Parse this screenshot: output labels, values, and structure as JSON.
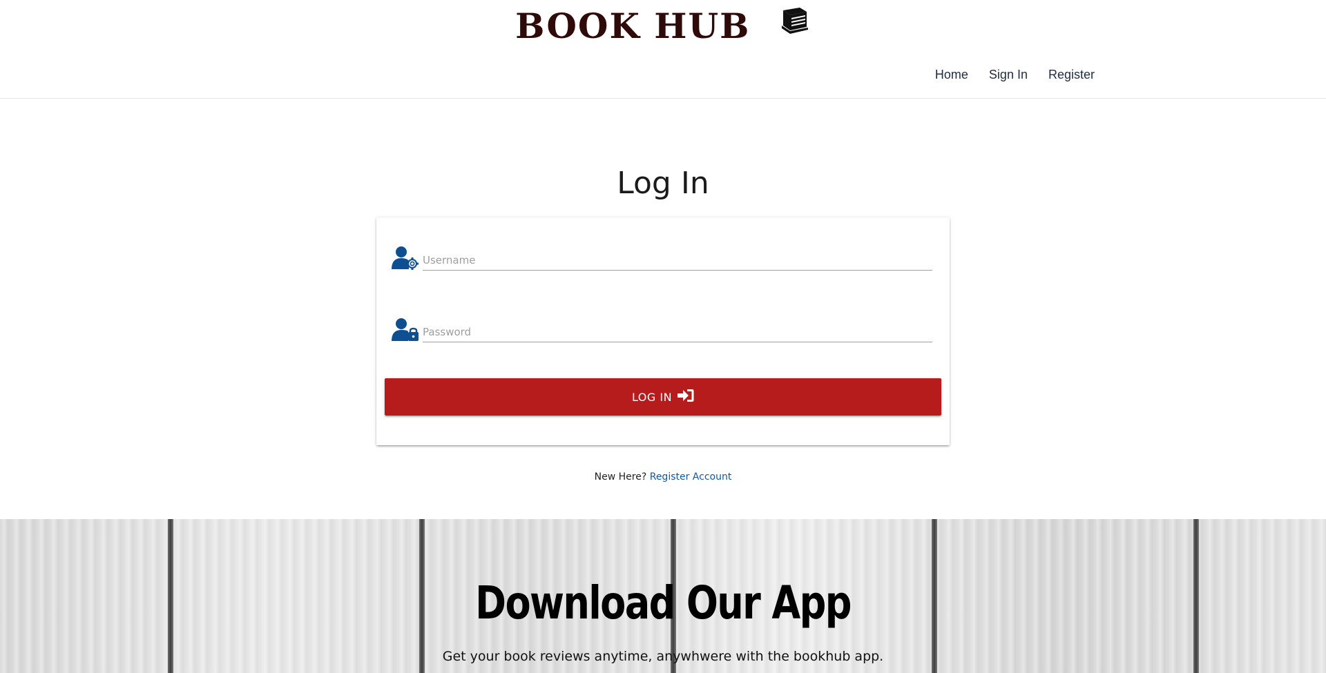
{
  "header": {
    "brand": "BOOK HUB",
    "brand_icon": "book-stack-icon",
    "nav": [
      {
        "label": "Home"
      },
      {
        "label": "Sign In"
      },
      {
        "label": "Register"
      }
    ]
  },
  "main": {
    "title": "Log In",
    "username": {
      "placeholder": "Username",
      "value": "",
      "icon": "user-gear-icon"
    },
    "password": {
      "placeholder": "Password",
      "value": "",
      "icon": "user-lock-icon"
    },
    "login_button": {
      "label": "Log In",
      "icon": "sign-in-icon"
    },
    "register_prompt": "New Here?",
    "register_link": "Register Account"
  },
  "banner": {
    "title": "Download Our App",
    "subtitle": "Get your book reviews anytime, anywhwere with the bookhub app."
  },
  "colors": {
    "brand": "#2e0a09",
    "accent_red": "#b71c1c",
    "icon_blue": "#0d4f91",
    "link_blue": "#0d5aa7"
  }
}
